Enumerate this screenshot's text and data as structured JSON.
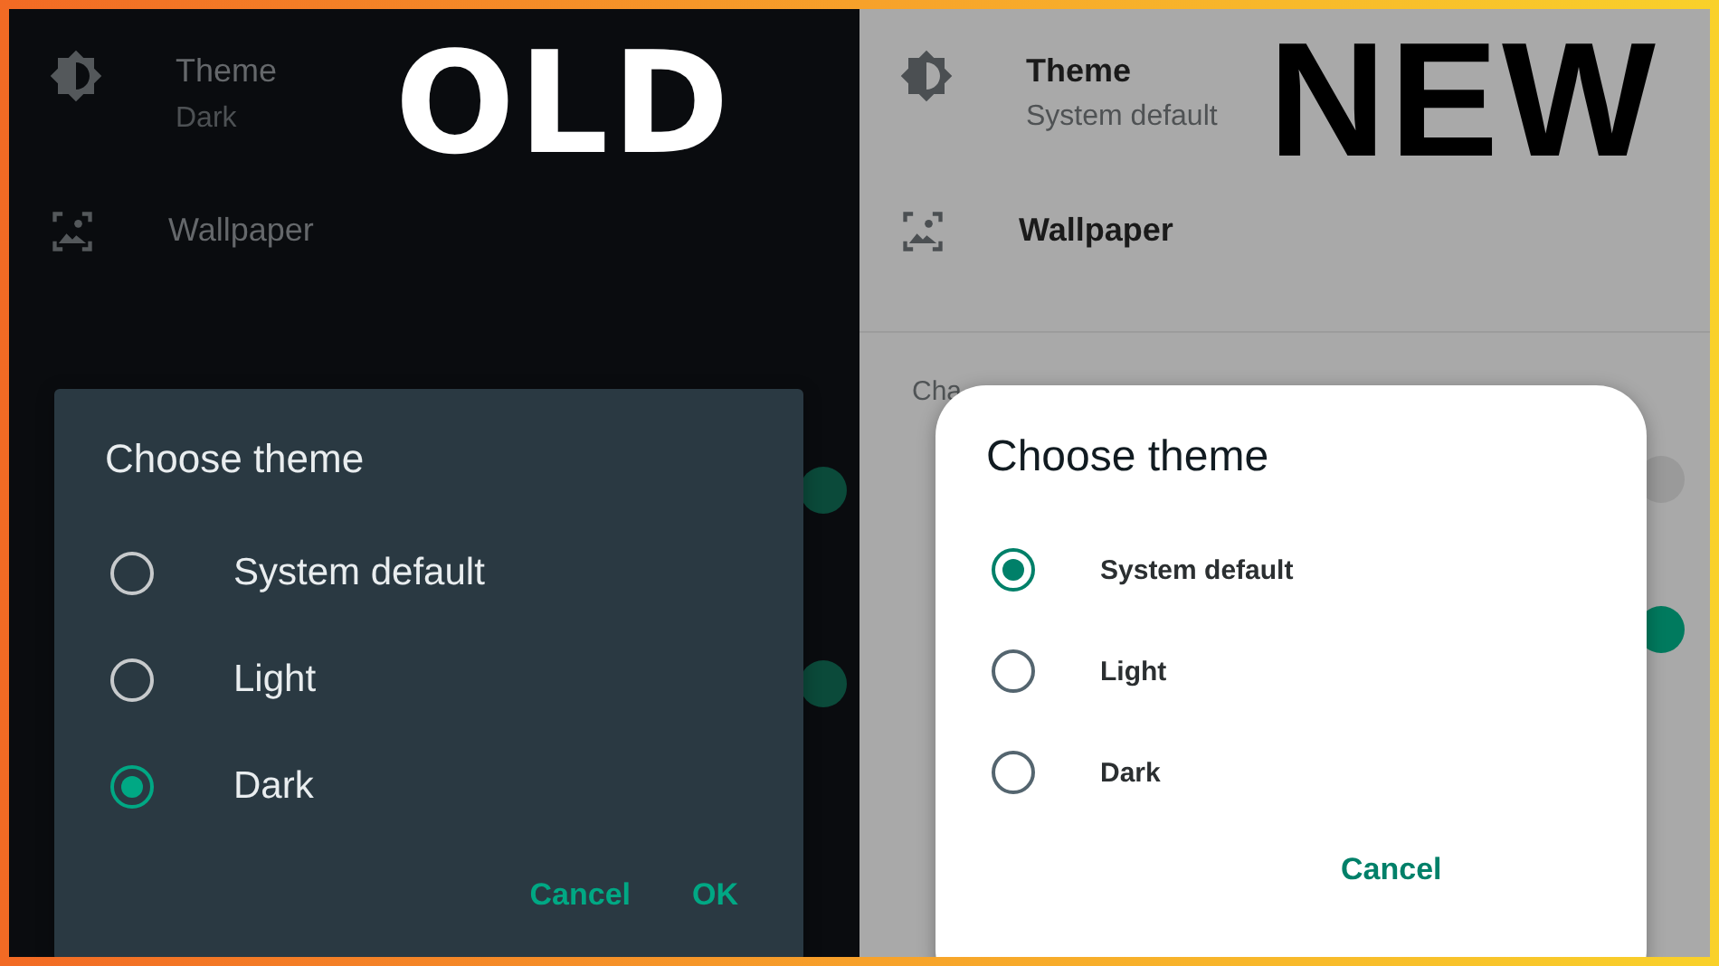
{
  "panels": [
    {
      "kind": "dark",
      "label": "OLD",
      "settings": [
        {
          "kind": "theme",
          "title": "Theme",
          "subtitle": "Dark"
        },
        {
          "kind": "wallpaper",
          "title": "Wallpaper"
        }
      ],
      "toggles": [
        {
          "on": true
        },
        {
          "on": true
        }
      ],
      "dialog": {
        "title": "Choose theme",
        "options": [
          {
            "label": "System default",
            "selected": false
          },
          {
            "label": "Light",
            "selected": false
          },
          {
            "label": "Dark",
            "selected": true
          }
        ],
        "buttons": [
          "Cancel",
          "OK"
        ]
      }
    },
    {
      "kind": "light",
      "label": "NEW",
      "settings": [
        {
          "kind": "theme",
          "title": "Theme",
          "subtitle": "System default"
        },
        {
          "kind": "wallpaper",
          "title": "Wallpaper"
        }
      ],
      "section_header": "Cha",
      "toggles": [
        {
          "on": false
        },
        {
          "on": true
        }
      ],
      "dialog": {
        "title": "Choose theme",
        "options": [
          {
            "label": "System default",
            "selected": true
          },
          {
            "label": "Light",
            "selected": false
          },
          {
            "label": "Dark",
            "selected": false
          }
        ],
        "buttons": [
          "Cancel"
        ]
      }
    }
  ]
}
